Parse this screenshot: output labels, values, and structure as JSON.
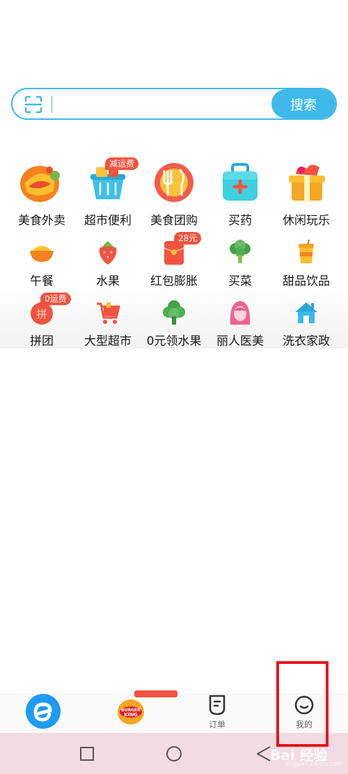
{
  "search": {
    "button_label": "搜索",
    "placeholder": "",
    "icon": "scan-icon"
  },
  "categories": [
    {
      "label": "美食外卖",
      "icon": "takeout-food-icon"
    },
    {
      "label": "超市便利",
      "icon": "shopping-basket-icon",
      "badge": "减运费"
    },
    {
      "label": "美食团购",
      "icon": "group-buy-food-icon"
    },
    {
      "label": "买药",
      "icon": "medicine-kit-icon"
    },
    {
      "label": "休闲玩乐",
      "icon": "leisure-icon"
    },
    {
      "label": "午餐",
      "icon": "lunch-bowl-icon"
    },
    {
      "label": "水果",
      "icon": "strawberry-icon"
    },
    {
      "label": "红包膨胀",
      "icon": "red-envelope-icon",
      "badge": "28元"
    },
    {
      "label": "买菜",
      "icon": "broccoli-icon"
    },
    {
      "label": "甜品饮品",
      "icon": "drink-cup-icon"
    },
    {
      "label": "拼团",
      "icon": "group-order-icon",
      "badge": "0运费",
      "icon_text": "拼"
    },
    {
      "label": "大型超市",
      "icon": "shopping-cart-icon"
    },
    {
      "label": "0元领水果",
      "icon": "tree-icon"
    },
    {
      "label": "丽人医美",
      "icon": "beauty-woman-icon"
    },
    {
      "label": "洗衣家政",
      "icon": "house-icon"
    }
  ],
  "bottom_nav": {
    "home_icon": "eleme-logo-icon",
    "promo_logo_text": "BURGER KING",
    "orders_label": "订单",
    "mine_label": "我的"
  },
  "watermark": {
    "text": "Bai 经验",
    "sub": "jingyan.baidu.com"
  },
  "colors": {
    "accent": "#3fb8ea",
    "badge": "#f2533e",
    "highlight": "#e8161d",
    "system_nav": "#f2dbe2"
  }
}
